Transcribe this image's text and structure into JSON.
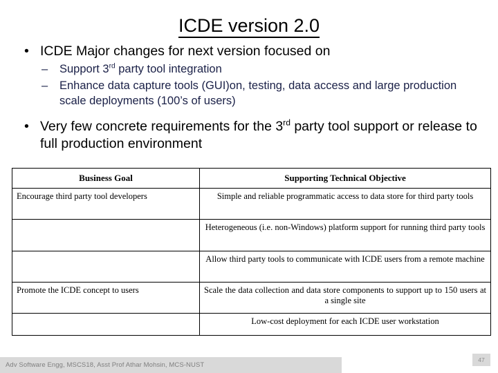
{
  "slide": {
    "title": "ICDE version 2.0",
    "page_number": "47",
    "footer": "Adv Software Engg, MSCS18, Asst Prof Athar Mohsin, MCS-NUST",
    "colors": {
      "title_text": "#000000",
      "level1_text": "#000000",
      "level2_text": "#1a2047",
      "footer_bar": "#d9d9d9",
      "footer_text": "#7f7f7f",
      "table_border": "#000000",
      "background": "#ffffff"
    }
  },
  "bullets": {
    "b1": {
      "marker": "•",
      "text": "ICDE Major changes for next version focused on"
    },
    "b1s1": {
      "marker": "–",
      "text_before": "Support 3",
      "sup": "rd",
      "text_after": " party tool integration"
    },
    "b1s2": {
      "marker": "–",
      "text": "Enhance data capture tools (GUI)on, testing, data access and large production scale deployments (100’s of users)"
    },
    "b2": {
      "marker": "•",
      "text_before": "Very few concrete requirements for the 3",
      "sup": "rd",
      "text_after": " party tool support or release to full production environment"
    }
  },
  "table": {
    "headers": {
      "col1": "Business Goal",
      "col2": "Supporting Technical Objective"
    },
    "rows": [
      {
        "goal": "Encourage third party tool developers",
        "objective": "Simple and reliable programmatic access to data store for third party tools"
      },
      {
        "goal": "",
        "objective": "Heterogeneous (i.e. non-Windows) platform support for running third party tools"
      },
      {
        "goal": "",
        "objective": "Allow third party tools to communicate with ICDE users from a remote machine"
      },
      {
        "goal": "Promote the ICDE concept to users",
        "objective": "Scale the data collection and data store components to support up to 150 users at a single site"
      },
      {
        "goal": "",
        "objective": "Low-cost deployment for each ICDE user workstation"
      }
    ]
  }
}
